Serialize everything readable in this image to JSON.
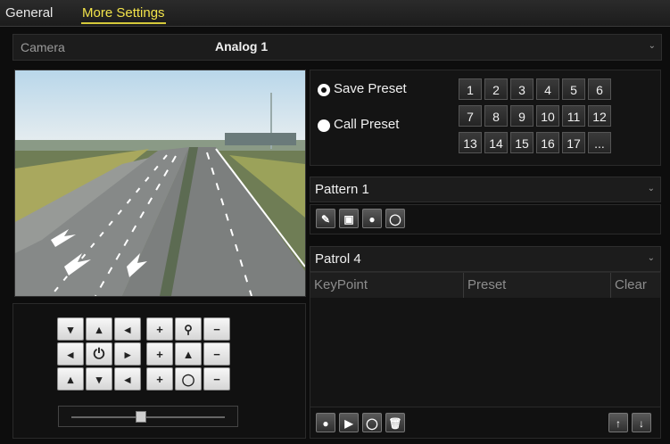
{
  "tabs": [
    {
      "label": "General"
    },
    {
      "label": "More Settings"
    }
  ],
  "camera": {
    "label": "Camera",
    "value": "Analog 1"
  },
  "preset": {
    "save_label": "Save Preset",
    "call_label": "Call Preset",
    "selected": "Save Preset",
    "numbers": [
      "1",
      "2",
      "3",
      "4",
      "5",
      "6",
      "7",
      "8",
      "9",
      "10",
      "11",
      "12",
      "13",
      "14",
      "15",
      "16",
      "17",
      "..."
    ]
  },
  "pattern": {
    "value": "Pattern 1"
  },
  "patrol": {
    "value": "Patrol 4",
    "columns": [
      "KeyPoint",
      "Preset",
      "Clear"
    ]
  },
  "ptz": {
    "zoom_level": 0.45
  },
  "colors": {
    "active_tab": "#f2e34a",
    "background": "#0d0d0d"
  }
}
